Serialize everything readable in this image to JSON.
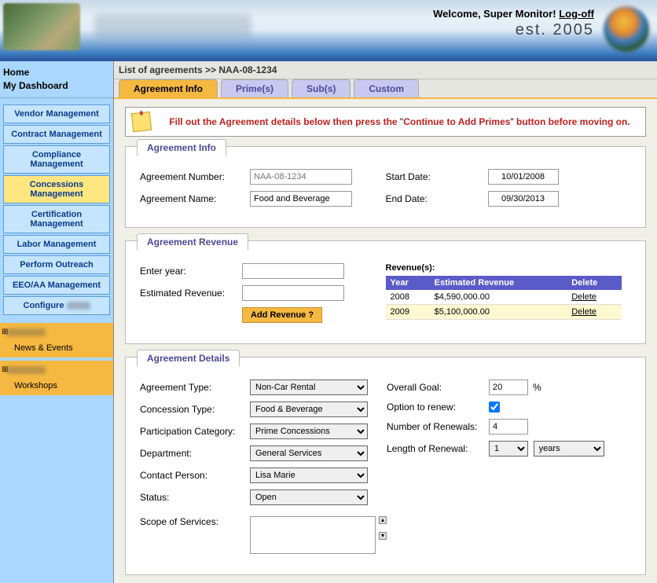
{
  "header": {
    "welcome_prefix": "Welcome, Super Monitor! ",
    "logoff": "Log-off",
    "tagline": "est. 2005"
  },
  "sidebar": {
    "home": "Home",
    "dashboard": "My Dashboard",
    "items": [
      {
        "label": "Vendor Management",
        "active": false
      },
      {
        "label": "Contract Management",
        "active": false
      },
      {
        "label": "Compliance Management",
        "active": false
      },
      {
        "label": "Concessions Management",
        "active": true
      },
      {
        "label": "Certification Management",
        "active": false
      },
      {
        "label": "Labor Management",
        "active": false
      },
      {
        "label": "Perform Outreach",
        "active": false
      },
      {
        "label": "EEO/AA Management",
        "active": false
      },
      {
        "label": "Configure",
        "active": false
      }
    ],
    "group1_link": "News & Events",
    "group2_link": "Workshops"
  },
  "crumb": "List of agreements >> NAA-08-1234",
  "tabs": [
    {
      "label": "Agreement Info",
      "active": true
    },
    {
      "label": "Prime(s)",
      "active": false
    },
    {
      "label": "Sub(s)",
      "active": false
    },
    {
      "label": "Custom",
      "active": false
    }
  ],
  "instruction": {
    "pre": "Fill out the Agreement details below then press the ",
    "quote_open": "\"",
    "highlight": "Continue to Add Primes",
    "quote_close": "\"",
    "post": " button before moving on."
  },
  "section_info": {
    "title": "Agreement Info",
    "num_label": "Agreement Number:",
    "num_placeholder": "NAA-08-1234",
    "name_label": "Agreement Name:",
    "name_value": "Food and Beverage",
    "start_label": "Start Date:",
    "start_value": "10/01/2008",
    "end_label": "End Date:",
    "end_value": "09/30/2013"
  },
  "section_rev": {
    "title": "Agreement Revenue",
    "year_label": "Enter year:",
    "est_label": "Estimated Revenue:",
    "add_btn": "Add Revenue ?",
    "list_title": "Revenue(s):",
    "th_year": "Year",
    "th_rev": "Estimated Revenue",
    "th_del": "Delete",
    "rows": [
      {
        "year": "2008",
        "rev": "$4,590,000.00",
        "del": "Delete"
      },
      {
        "year": "2009",
        "rev": "$5,100,000.00",
        "del": "Delete"
      }
    ]
  },
  "section_det": {
    "title": "Agreement Details",
    "type_label": "Agreement Type:",
    "type_value": "Non-Car Rental",
    "conc_label": "Concession Type:",
    "conc_value": "Food & Beverage",
    "part_label": "Participation Category:",
    "part_value": "Prime Concessions",
    "dept_label": "Department:",
    "dept_value": "General Services",
    "contact_label": "Contact Person:",
    "contact_value": "Lisa Marie",
    "status_label": "Status:",
    "status_value": "Open",
    "goal_label": "Overall Goal:",
    "goal_value": "20",
    "goal_unit": "%",
    "renew_label": "Option to renew:",
    "renew_checked": true,
    "numren_label": "Number of Renewals:",
    "numren_value": "4",
    "len_label": "Length of Renewal:",
    "len_value": "1",
    "len_unit": "years",
    "scope_label": "Scope of Services:"
  }
}
